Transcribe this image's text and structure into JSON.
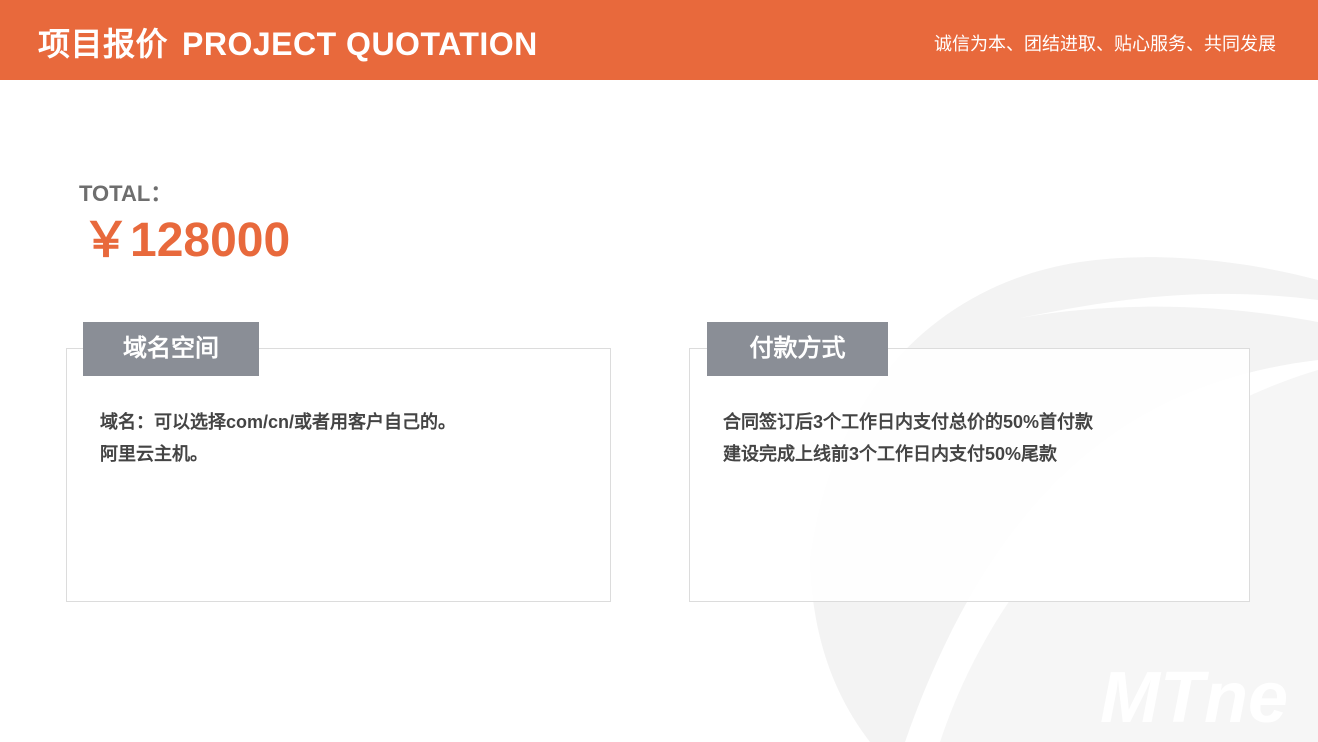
{
  "header": {
    "title_cn": "项目报价",
    "title_en": "PROJECT QUOTATION",
    "slogan": "诚信为本、团结进取、贴心服务、共同发展"
  },
  "total": {
    "label": "TOTAL：",
    "value": "￥128000"
  },
  "domain_card": {
    "tab": "域名空间",
    "lines": [
      "域名：可以选择com/cn/或者用客户自己的。",
      "阿里云主机。"
    ]
  },
  "payment_card": {
    "tab": "付款方式",
    "lines": [
      "合同签订后3个工作日内支付总价的50%首付款",
      "建设完成上线前3个工作日内支付50%尾款"
    ]
  },
  "watermark": {
    "text": "MTne"
  },
  "colors": {
    "accent": "#e8693c",
    "tab_gray": "#8a8e96",
    "text_dark": "#444444"
  }
}
